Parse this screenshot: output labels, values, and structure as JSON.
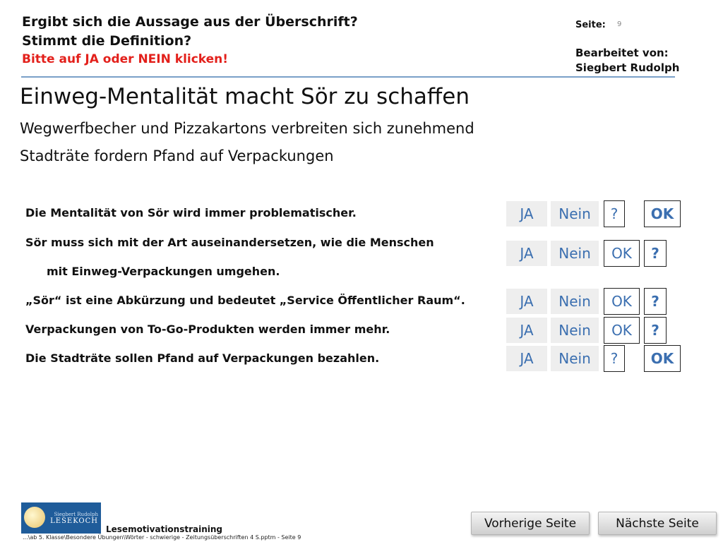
{
  "header": {
    "question1": "Ergibt sich die Aussage aus der Überschrift?",
    "question2": "Stimmt die Definition?",
    "instruction": "Bitte auf JA oder NEIN klicken!",
    "page_label": "Seite:",
    "page_number": "9",
    "edited_by_label": "Bearbeitet von:",
    "edited_by_name": "Siegbert Rudolph"
  },
  "main": {
    "title": "Einweg-Mentalität macht Sör zu schaffen",
    "subtitle1": "Wegwerfbecher und Pizzakartons verbreiten sich zunehmend",
    "subtitle2": "Stadträte fordern Pfand auf Verpackungen"
  },
  "statements": [
    {
      "text": "Die Mentalität von Sör wird immer problematischer."
    },
    {
      "text": "Sör muss sich mit der Art auseinandersetzen, wie die Menschen",
      "text2": "mit Einweg-Verpackungen umgehen."
    },
    {
      "text": "„Sör“ ist eine Abkürzung und bedeutet „Service Öffentlicher Raum“."
    },
    {
      "text": "Verpackungen von To-Go-Produkten werden immer mehr."
    },
    {
      "text": "Die Stadträte sollen Pfand auf Verpackungen bezahlen."
    }
  ],
  "buttons": {
    "ja": "JA",
    "nein": "Nein",
    "ok": "OK",
    "question": "?"
  },
  "footer": {
    "logo_small": "Siegbert Rudolph",
    "logo_big": "LESEKOCH",
    "label": "Lesemotivationstraining",
    "path": "...\\ab 5. Klasse\\Besondere Übungen\\Wörter - schwierige - Zeitungsüberschriften 4 S.pptm - Seite 9",
    "prev": "Vorherige Seite",
    "next": "Nächste Seite"
  },
  "colors": {
    "instruction": "#e3201b",
    "button_text": "#3b6fb0",
    "rule": "#7aa0c8",
    "logo_bg": "#1f5c9a"
  }
}
